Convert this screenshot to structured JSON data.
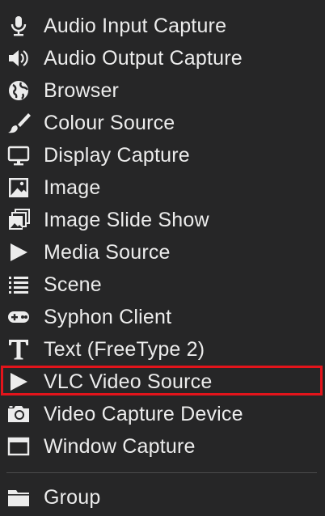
{
  "menu": {
    "items": [
      {
        "label": "Audio Input Capture",
        "icon": "microphone-icon"
      },
      {
        "label": "Audio Output Capture",
        "icon": "speaker-icon"
      },
      {
        "label": "Browser",
        "icon": "globe-icon"
      },
      {
        "label": "Colour Source",
        "icon": "paintbrush-icon"
      },
      {
        "label": "Display Capture",
        "icon": "monitor-icon"
      },
      {
        "label": "Image",
        "icon": "image-icon"
      },
      {
        "label": "Image Slide Show",
        "icon": "slideshow-icon"
      },
      {
        "label": "Media Source",
        "icon": "play-icon"
      },
      {
        "label": "Scene",
        "icon": "list-icon"
      },
      {
        "label": "Syphon Client",
        "icon": "gamepad-icon"
      },
      {
        "label": "Text (FreeType 2)",
        "icon": "text-icon"
      },
      {
        "label": "VLC Video Source",
        "icon": "play-icon",
        "highlighted": true
      },
      {
        "label": "Video Capture Device",
        "icon": "camera-icon"
      },
      {
        "label": "Window Capture",
        "icon": "window-icon"
      }
    ],
    "group_item": {
      "label": "Group",
      "icon": "folder-icon"
    }
  },
  "colors": {
    "background": "#262627",
    "text": "#ececec",
    "highlight_border": "#e3141b"
  }
}
